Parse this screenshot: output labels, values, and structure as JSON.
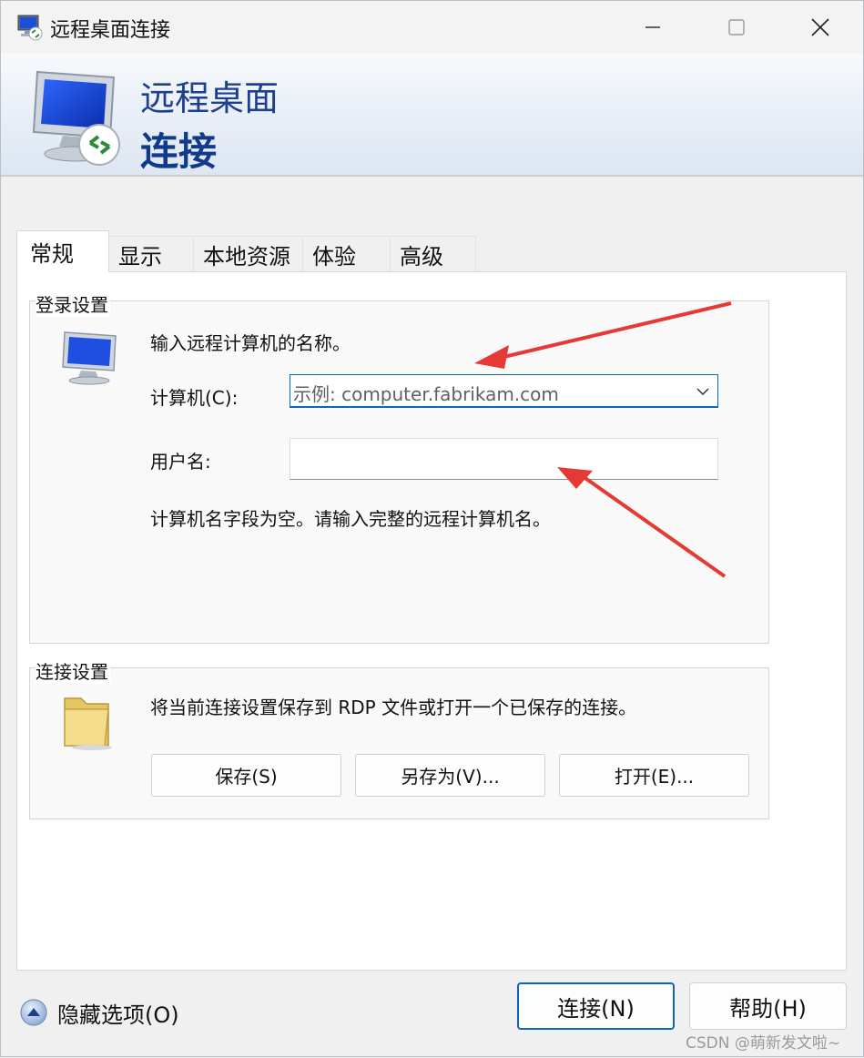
{
  "window": {
    "title": "远程桌面连接"
  },
  "banner": {
    "line1": "远程桌面",
    "line2": "连接"
  },
  "tabs": [
    {
      "label": "常规",
      "active": true
    },
    {
      "label": "显示",
      "active": false
    },
    {
      "label": "本地资源",
      "active": false
    },
    {
      "label": "体验",
      "active": false
    },
    {
      "label": "高级",
      "active": false
    }
  ],
  "login": {
    "group_title": "登录设置",
    "prompt": "输入远程计算机的名称。",
    "computer_label": "计算机(C):",
    "computer_placeholder": "示例: computer.fabrikam.com",
    "username_label": "用户名:",
    "username_value": "",
    "hint": "计算机名字段为空。请输入完整的远程计算机名。"
  },
  "connection": {
    "group_title": "连接设置",
    "description": "将当前连接设置保存到 RDP 文件或打开一个已保存的连接。",
    "save_label": "保存(S)",
    "save_as_label": "另存为(V)...",
    "open_label": "打开(E)..."
  },
  "footer": {
    "hide_options_label": "隐藏选项(O)",
    "connect_label": "连接(N)",
    "help_label": "帮助(H)"
  },
  "watermark": "CSDN @萌新发文啦~",
  "colors": {
    "accent": "#0a66c2",
    "banner_text": "#1d3f8f",
    "annotation": "#e53935"
  }
}
